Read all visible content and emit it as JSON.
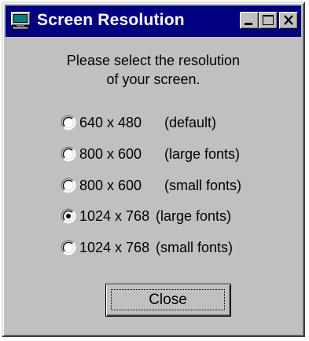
{
  "window": {
    "title": "Screen Resolution",
    "app_icon": "monitor-icon",
    "controls": {
      "minimize_icon": "minimize-icon",
      "maximize_icon": "maximize-icon",
      "close_icon": "close-icon"
    }
  },
  "prompt": {
    "line1": "Please select the resolution",
    "line2": "of your screen."
  },
  "options": [
    {
      "resolution": "640 x 480",
      "note": "(default)",
      "selected": false
    },
    {
      "resolution": "800 x 600",
      "note": "(large fonts)",
      "selected": false
    },
    {
      "resolution": "800 x 600",
      "note": "(small fonts)",
      "selected": false
    },
    {
      "resolution": "1024 x 768",
      "note": "(large fonts)",
      "selected": true
    },
    {
      "resolution": "1024 x 768",
      "note": "(small fonts)",
      "selected": false
    }
  ],
  "close_button": {
    "label": "Close"
  },
  "colors": {
    "titlebar": "#000080",
    "face": "#c0c0c0",
    "title_text": "#ffffff"
  }
}
